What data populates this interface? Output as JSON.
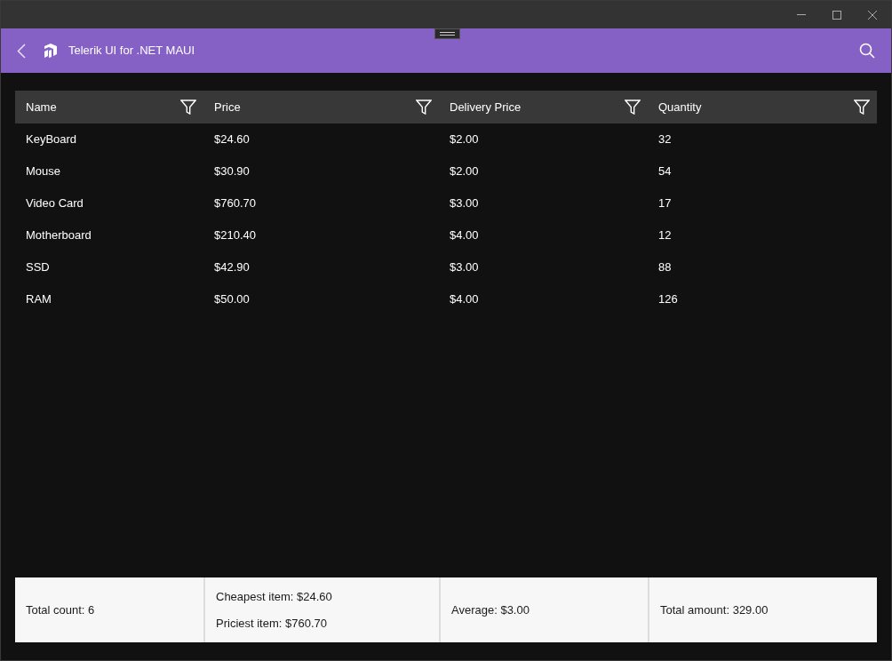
{
  "app_bar": {
    "title": "Telerik UI for .NET MAUI"
  },
  "grid": {
    "columns": [
      "Name",
      "Price",
      "Delivery Price",
      "Quantity"
    ],
    "rows": [
      [
        "KeyBoard",
        "$24.60",
        "$2.00",
        "32"
      ],
      [
        "Mouse",
        "$30.90",
        "$2.00",
        "54"
      ],
      [
        "Video Card",
        "$760.70",
        "$3.00",
        "17"
      ],
      [
        "Motherboard",
        "$210.40",
        "$4.00",
        "12"
      ],
      [
        "SSD",
        "$42.90",
        "$3.00",
        "88"
      ],
      [
        "RAM",
        "$50.00",
        "$4.00",
        "126"
      ]
    ],
    "footer": [
      [
        "Total count:  6"
      ],
      [
        "Cheapest item:  $24.60",
        "Priciest item:  $760.70"
      ],
      [
        "Average:  $3.00"
      ],
      [
        "Total amount:  329.00"
      ]
    ]
  }
}
